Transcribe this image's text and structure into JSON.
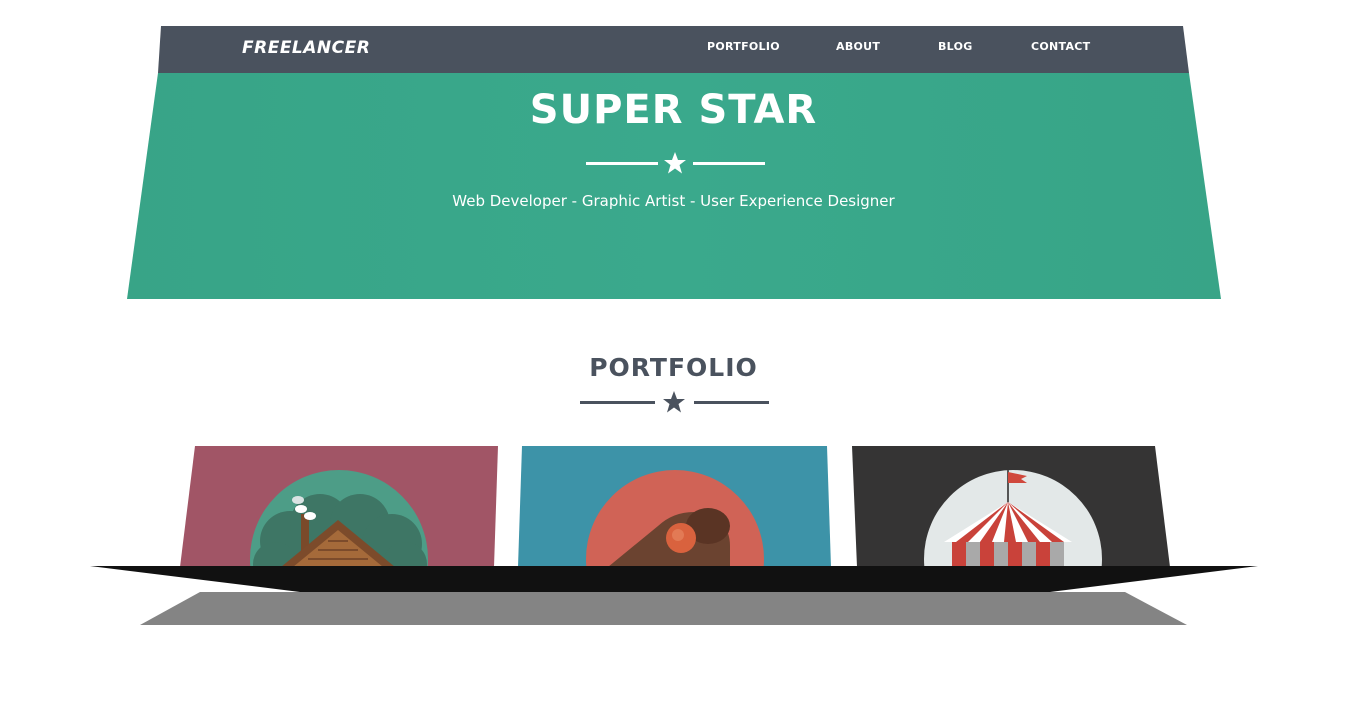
{
  "navbar": {
    "brand": "FREELANCER",
    "items": [
      {
        "label": "PORTFOLIO"
      },
      {
        "label": "ABOUT"
      },
      {
        "label": "BLOG"
      },
      {
        "label": "CONTACT"
      }
    ]
  },
  "hero": {
    "title": "SUPER STAR",
    "subtitle": "Web Developer - Graphic Artist - User Experience Designer",
    "divider_icon": "star-icon"
  },
  "portfolio": {
    "title": "PORTFOLIO",
    "divider_icon": "star-icon",
    "items": [
      {
        "icon": "cabin-icon",
        "background": "#a15566"
      },
      {
        "icon": "cake-icon",
        "background": "#3d93a8"
      },
      {
        "icon": "circus-tent-icon",
        "background": "#353434"
      }
    ]
  },
  "colors": {
    "navbar": "#4a525e",
    "hero": "#38a688",
    "text_dark": "#4a525e",
    "white": "#ffffff"
  }
}
